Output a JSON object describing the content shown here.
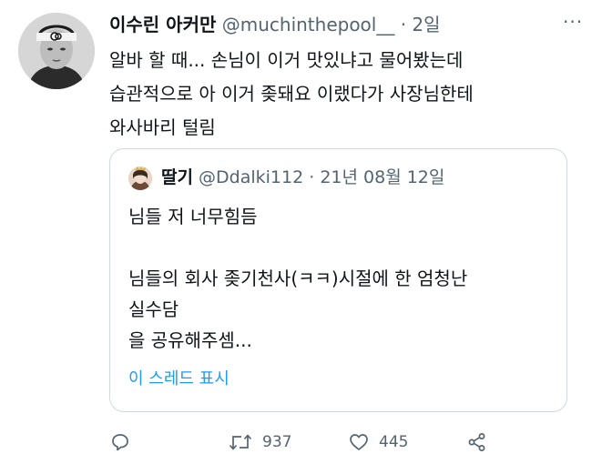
{
  "tweet": {
    "display_name": "이수린 아커만",
    "handle": "@muchinthepool__",
    "separator": "·",
    "time": "2일",
    "more": "···",
    "lines": [
      "알바 할 때... 손님이 이거 맛있냐고 물어봤는데",
      "습관적으로 아 이거 좆돼요 이랬다가 사장님한테",
      "와사바리 털림"
    ]
  },
  "quoted": {
    "display_name": "딸기",
    "handle": "@Ddalki112",
    "separator": "·",
    "time": "21년 08월 12일",
    "lines": [
      "님들 저 너무힘듬",
      "",
      "님들의 회사 좆기천사(ㅋㅋ)시절에 한 엄청난",
      "실수담",
      "을 공유해주셈..."
    ],
    "show_thread": "이 스레드 표시"
  },
  "actions": {
    "reply_icon": "reply-icon",
    "retweet_icon": "retweet-icon",
    "retweet_count": "937",
    "like_icon": "heart-icon",
    "like_count": "445",
    "share_icon": "share-icon"
  },
  "colors": {
    "text": "#0f1419",
    "muted": "#536471",
    "link": "#1d9bf0",
    "border": "#cfd9de"
  }
}
